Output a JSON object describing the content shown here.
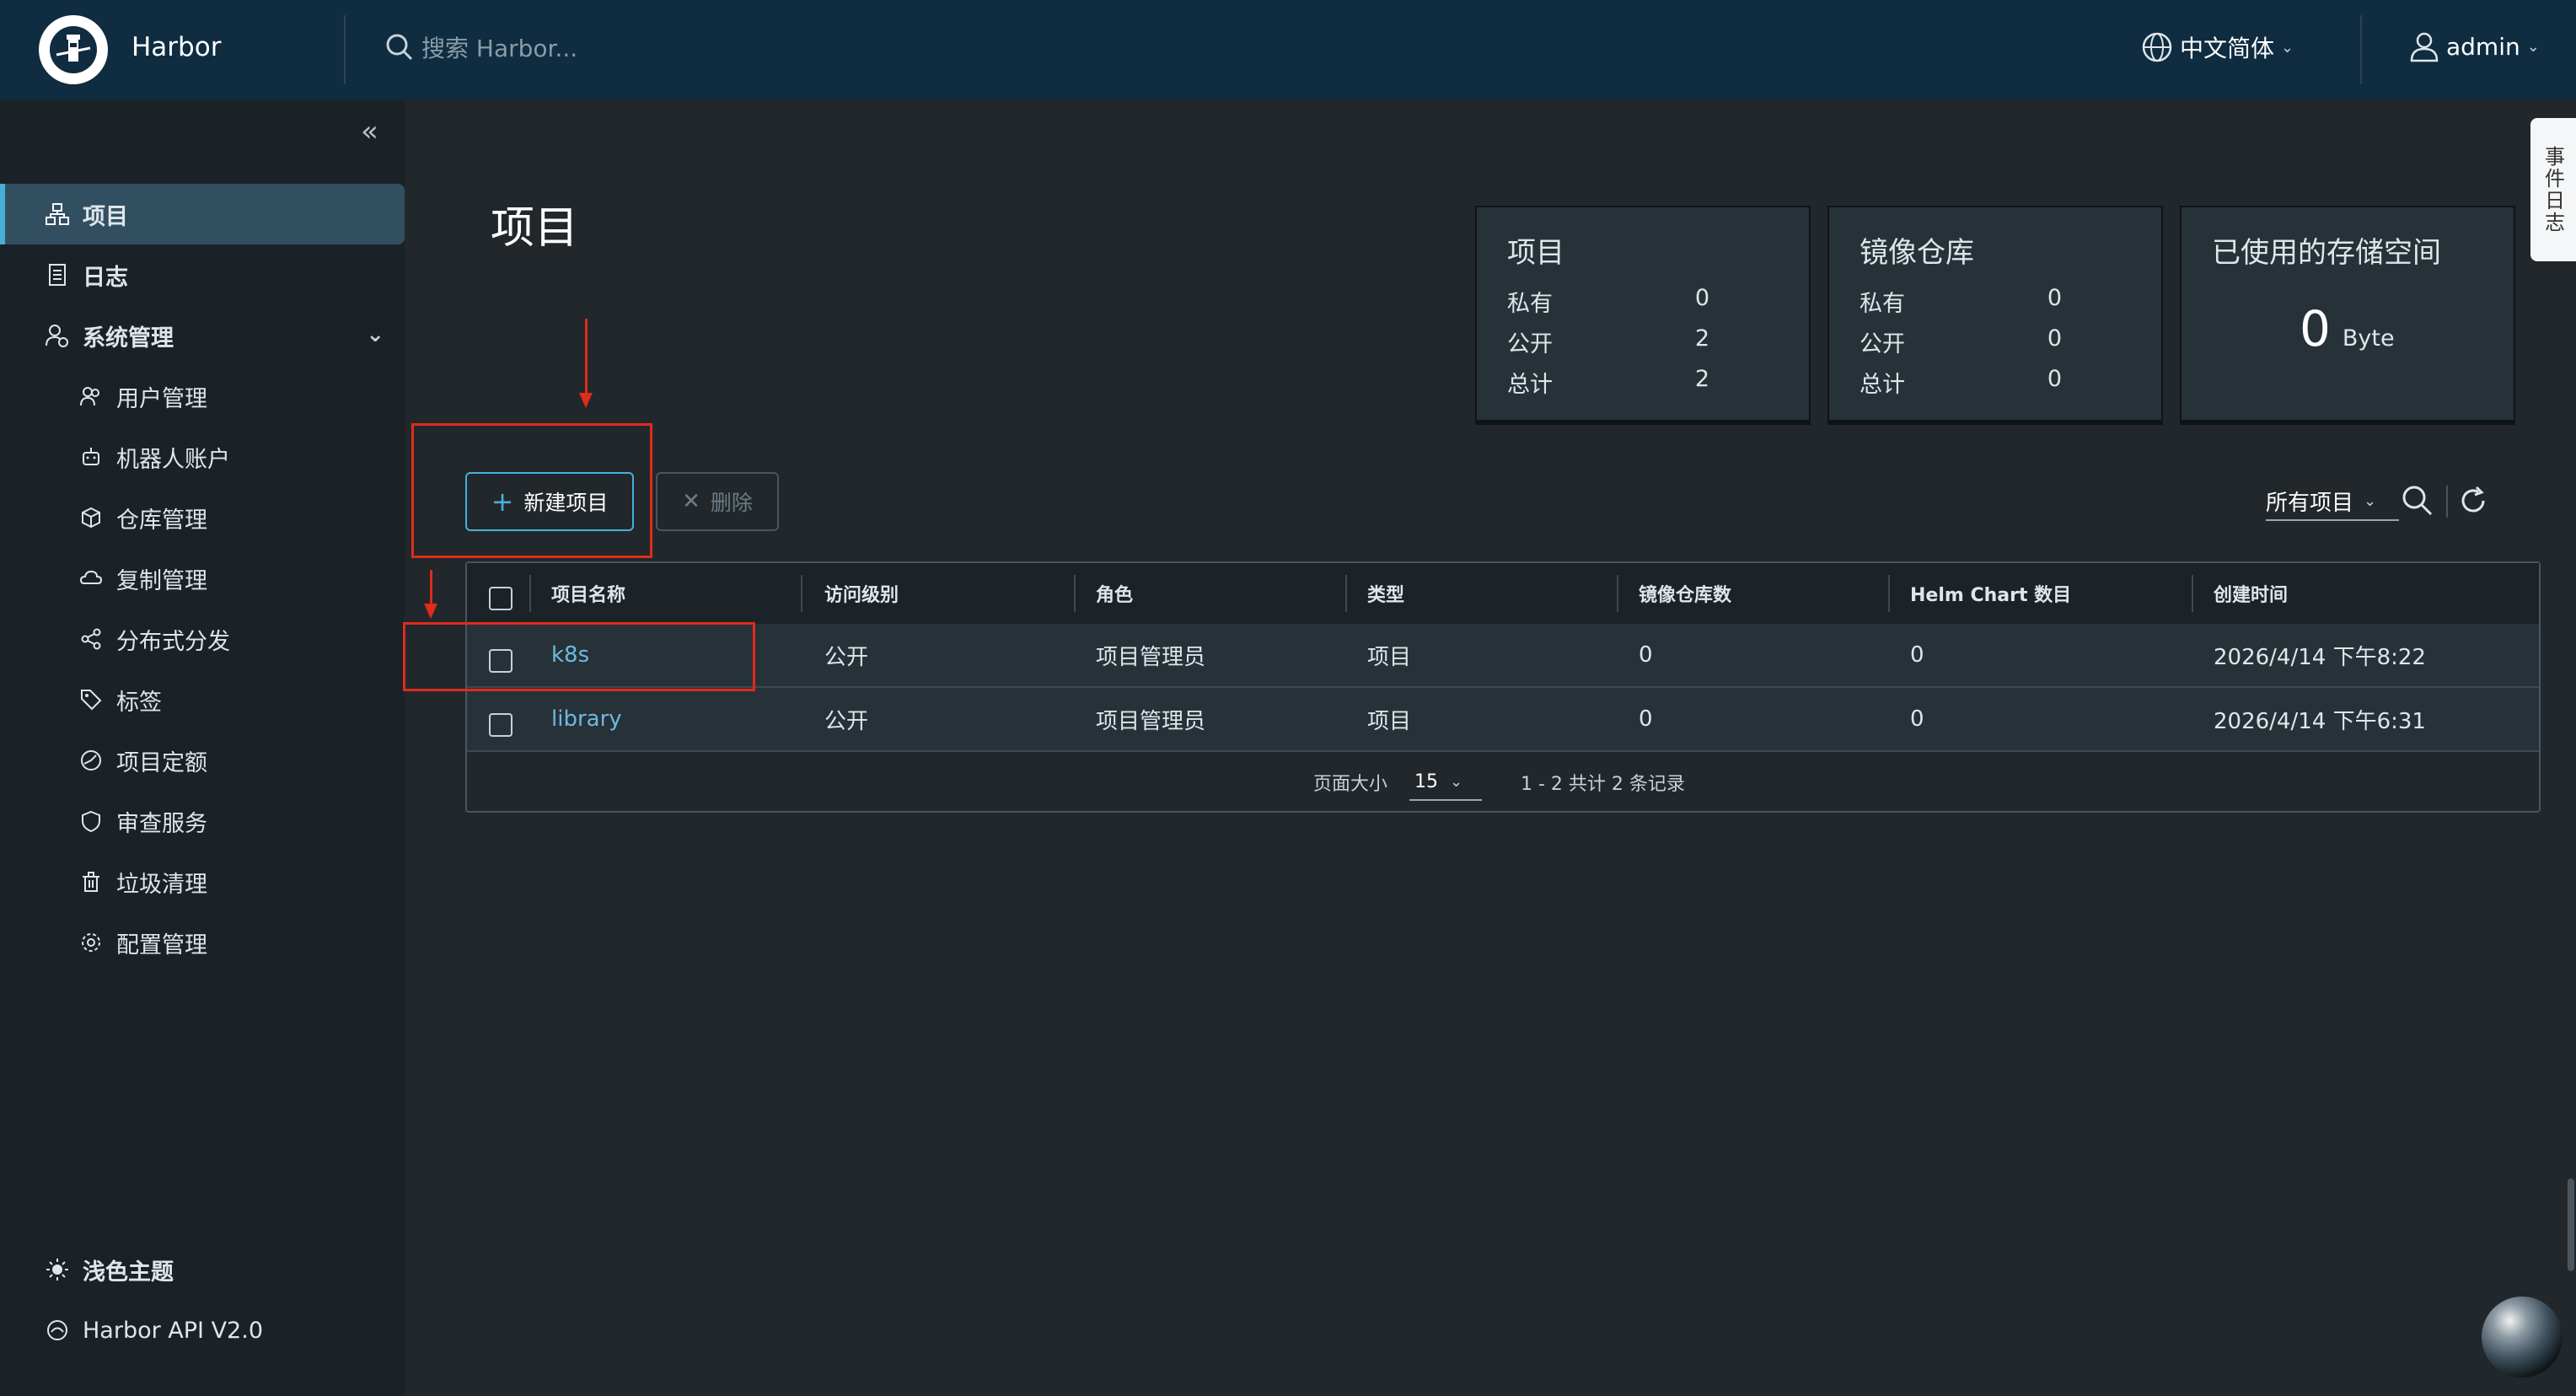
{
  "header": {
    "app_title": "Harbor",
    "search_placeholder": "搜索 Harbor...",
    "language": "中文简体",
    "user": "admin"
  },
  "sidebar": {
    "items": [
      {
        "label": "项目",
        "icon": "projects-icon"
      },
      {
        "label": "日志",
        "icon": "logs-icon"
      },
      {
        "label": "系统管理",
        "icon": "system-admin-icon"
      }
    ],
    "sub_items": [
      {
        "label": "用户管理",
        "icon": "users-icon"
      },
      {
        "label": "机器人账户",
        "icon": "robot-icon"
      },
      {
        "label": "仓库管理",
        "icon": "registry-icon"
      },
      {
        "label": "复制管理",
        "icon": "replication-icon"
      },
      {
        "label": "分布式分发",
        "icon": "share-icon"
      },
      {
        "label": "标签",
        "icon": "tag-icon"
      },
      {
        "label": "项目定额",
        "icon": "quota-icon"
      },
      {
        "label": "审查服务",
        "icon": "shield-icon"
      },
      {
        "label": "垃圾清理",
        "icon": "trash-icon"
      },
      {
        "label": "配置管理",
        "icon": "gear-icon"
      }
    ],
    "footer": {
      "theme_label": "浅色主题",
      "api_label": "Harbor API V2.0"
    }
  },
  "main": {
    "title": "项目",
    "stats": {
      "projects": {
        "title": "项目",
        "rows": [
          {
            "label": "私有",
            "value": "0"
          },
          {
            "label": "公开",
            "value": "2"
          },
          {
            "label": "总计",
            "value": "2"
          }
        ]
      },
      "repositories": {
        "title": "镜像仓库",
        "rows": [
          {
            "label": "私有",
            "value": "0"
          },
          {
            "label": "公开",
            "value": "0"
          },
          {
            "label": "总计",
            "value": "0"
          }
        ]
      },
      "storage": {
        "title": "已使用的存储空间",
        "value": "0",
        "unit": "Byte"
      }
    },
    "buttons": {
      "new_project": "新建项目",
      "delete": "删除"
    },
    "filter": "所有项目",
    "table": {
      "columns": [
        "项目名称",
        "访问级别",
        "角色",
        "类型",
        "镜像仓库数",
        "Helm Chart 数目",
        "创建时间"
      ],
      "rows": [
        [
          "k8s",
          "公开",
          "项目管理员",
          "项目",
          "0",
          "0",
          "2026/4/14 下午8:22"
        ],
        [
          "library",
          "公开",
          "项目管理员",
          "项目",
          "0",
          "0",
          "2026/4/14 下午6:31"
        ]
      ],
      "page_size_label": "页面大小",
      "page_size": "15",
      "summary": "1 - 2 共计 2 条记录"
    }
  },
  "side_tab": "事件日志",
  "colors": {
    "header_bg": "#0f2c40",
    "sidebar_bg": "#1a2227",
    "page_bg": "#21272b",
    "accent": "#49afd9",
    "link": "#6fb8e0",
    "annotation": "#e02b1d"
  }
}
